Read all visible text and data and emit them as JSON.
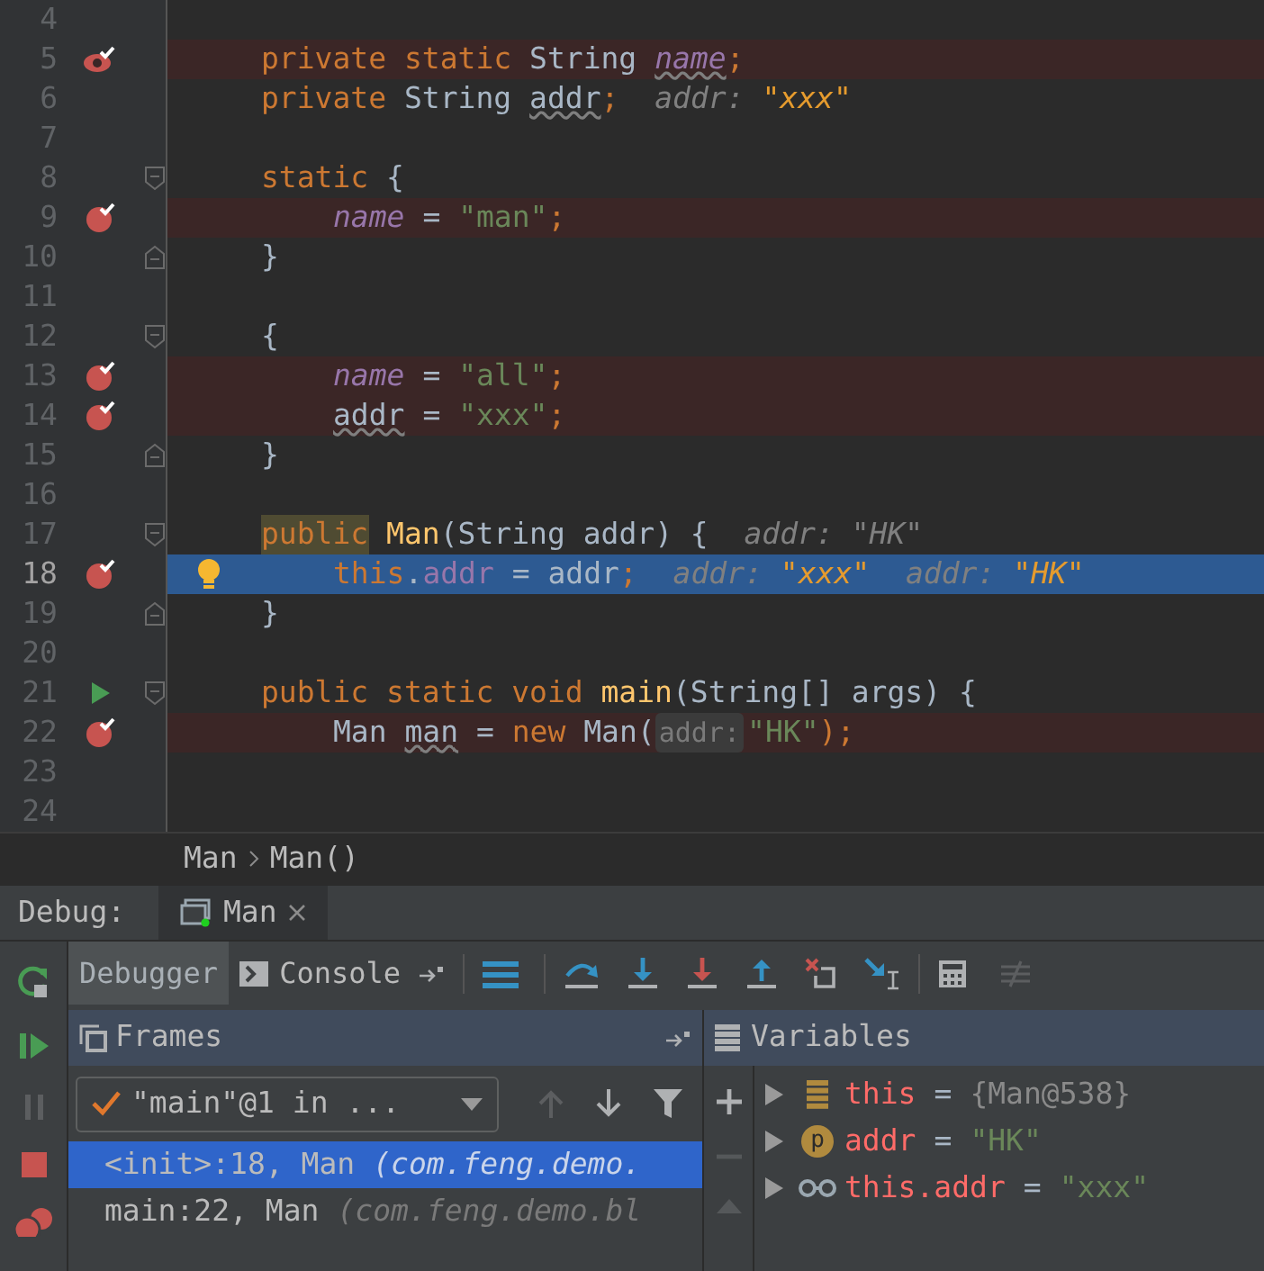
{
  "editor": {
    "lines": [
      {
        "number": "4",
        "kind": "code"
      },
      {
        "number": "5",
        "kind": "field_breakpoint",
        "tokens": [
          {
            "text": "private static",
            "kind": "keyword"
          },
          {
            "text": " String ",
            "kind": "plain"
          },
          {
            "text": "name",
            "kind": "unused_static"
          },
          {
            "text": ";",
            "kind": "punct"
          }
        ]
      },
      {
        "number": "6",
        "kind": "code",
        "tokens": [
          {
            "text": "private",
            "kind": "keyword"
          },
          {
            "text": " String ",
            "kind": "plain"
          },
          {
            "text": "addr",
            "kind": "unused"
          },
          {
            "text": ";",
            "kind": "punct"
          },
          {
            "text": "  addr:",
            "kind": "hint_name"
          },
          {
            "text": " \"xxx\"",
            "kind": "hint_value"
          }
        ]
      },
      {
        "number": "7",
        "kind": "code"
      },
      {
        "number": "8",
        "kind": "code",
        "tokens": [
          {
            "text": "static",
            "kind": "keyword"
          },
          {
            "text": " {",
            "kind": "plain"
          }
        ],
        "children": [
          {
            "number": "9",
            "kind": "breakpoint",
            "tokens": [
              {
                "text": "name",
                "kind": "static_field"
              },
              {
                "text": " = ",
                "kind": "plain"
              },
              {
                "text": "\"man\"",
                "kind": "string"
              },
              {
                "text": ";",
                "kind": "punct"
              }
            ]
          }
        ],
        "end": {
          "number": "10",
          "tokens": [
            {
              "text": "}",
              "kind": "plain"
            }
          ]
        }
      },
      {
        "number": "11",
        "kind": "code"
      },
      {
        "number": "12",
        "kind": "code",
        "tokens": [
          {
            "text": "{",
            "kind": "plain"
          }
        ],
        "children": [
          {
            "number": "13",
            "kind": "breakpoint",
            "tokens": [
              {
                "text": "name",
                "kind": "static_field"
              },
              {
                "text": " = ",
                "kind": "plain"
              },
              {
                "text": "\"all\"",
                "kind": "string"
              },
              {
                "text": ";",
                "kind": "punct"
              }
            ]
          },
          {
            "number": "14",
            "kind": "breakpoint",
            "tokens": [
              {
                "text": "addr",
                "kind": "unused"
              },
              {
                "text": " = ",
                "kind": "plain"
              },
              {
                "text": "\"xxx\"",
                "kind": "string"
              },
              {
                "text": ";",
                "kind": "punct"
              }
            ]
          }
        ],
        "end": {
          "number": "15",
          "tokens": [
            {
              "text": "}",
              "kind": "plain"
            }
          ]
        }
      },
      {
        "number": "16",
        "kind": "code"
      },
      {
        "number": "17",
        "kind": "code",
        "tokens": [
          {
            "text": "public",
            "kind": "matched_keyword"
          },
          {
            "text": " Man",
            "kind": "method"
          },
          {
            "text": "(String addr) {",
            "kind": "plain"
          },
          {
            "text": "  addr:",
            "kind": "hint_name"
          },
          {
            "text": " \"HK\"",
            "kind": "hint_plain"
          }
        ],
        "children": [
          {
            "number": "18",
            "kind": "current_breakpoint",
            "tokens": [
              {
                "text": "this",
                "kind": "keyword"
              },
              {
                "text": ".",
                "kind": "plain"
              },
              {
                "text": "addr",
                "kind": "field"
              },
              {
                "text": " = addr",
                "kind": "plain"
              },
              {
                "text": ";",
                "kind": "punct"
              },
              {
                "text": "  addr:",
                "kind": "hint_name"
              },
              {
                "text": " \"xxx\"",
                "kind": "hint_value"
              },
              {
                "text": "  addr:",
                "kind": "hint_name"
              },
              {
                "text": " \"HK\"",
                "kind": "hint_value"
              }
            ]
          }
        ],
        "end": {
          "number": "19",
          "tokens": [
            {
              "text": "}",
              "kind": "plain"
            }
          ]
        }
      },
      {
        "number": "20",
        "kind": "code"
      },
      {
        "number": "21",
        "kind": "run",
        "tokens": [
          {
            "text": "public static void",
            "kind": "keyword"
          },
          {
            "text": " main",
            "kind": "method"
          },
          {
            "text": "(String[] args) {",
            "kind": "plain"
          }
        ],
        "children": [
          {
            "number": "22",
            "kind": "breakpoint",
            "tokens": [
              {
                "text": "Man ",
                "kind": "plain"
              },
              {
                "text": "man",
                "kind": "unused"
              },
              {
                "text": " = ",
                "kind": "plain"
              },
              {
                "text": "new",
                "kind": "keyword"
              },
              {
                "text": " Man(",
                "kind": "plain"
              },
              {
                "text": "addr:",
                "kind": "param_hint"
              },
              {
                "text": "\"HK\"",
                "kind": "string"
              },
              {
                "text": ");",
                "kind": "punct"
              }
            ]
          },
          {
            "number": "23",
            "kind": "code"
          },
          {
            "number": "24",
            "kind": "code"
          }
        ]
      }
    ]
  },
  "breadcrumb": [
    "Man",
    "Man()"
  ],
  "debug_bar": {
    "label": "Debug:",
    "tabs": [
      {
        "label": "Man",
        "selected": true
      }
    ]
  },
  "debug_tabs": [
    {
      "label": "Debugger",
      "selected": true
    },
    {
      "label": "Console",
      "selected": false
    }
  ],
  "frames": {
    "title": "Frames",
    "thread": "\"main\"@1 in ...",
    "items": [
      {
        "location": "<init>:18, Man",
        "package": "(com.feng.demo.",
        "selected": true
      },
      {
        "location": "main:22, Man",
        "package": "(com.feng.demo.bl",
        "selected": false
      }
    ]
  },
  "variables": {
    "title": "Variables",
    "rows": [
      {
        "kind": "object",
        "name": "this",
        "operator": "=",
        "value": "{Man@538}"
      },
      {
        "kind": "parameter",
        "icon_letter": "p",
        "name": "addr",
        "operator": "=",
        "value": "\"HK\""
      },
      {
        "kind": "watch",
        "name": "this.addr",
        "operator": "=",
        "value": "\"xxx\""
      }
    ]
  }
}
